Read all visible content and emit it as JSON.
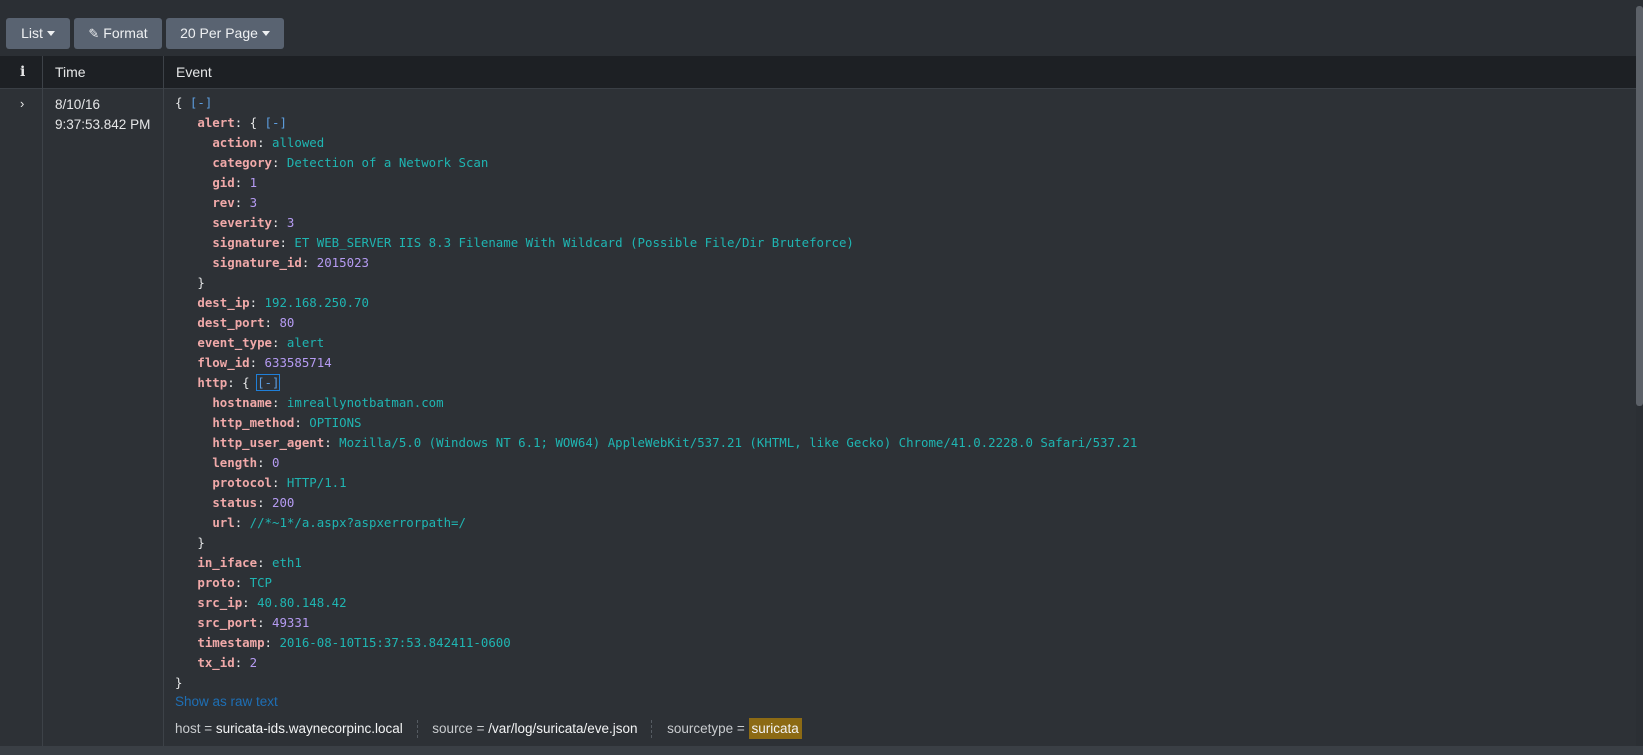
{
  "toolbar": {
    "list_label": "List",
    "format_label": "Format",
    "per_page_label": "20 Per Page"
  },
  "table": {
    "col_info": "i",
    "col_time": "Time",
    "col_event": "Event"
  },
  "event": {
    "time_date": "8/10/16",
    "time_clock": "9:37:53.842 PM",
    "toggle": "[-]",
    "fields": {
      "alert": "alert",
      "action_key": "action",
      "action_val": "allowed",
      "category_key": "category",
      "category_val": "Detection of a Network Scan",
      "gid_key": "gid",
      "gid_val": "1",
      "rev_key": "rev",
      "rev_val": "3",
      "severity_key": "severity",
      "severity_val": "3",
      "signature_key": "signature",
      "signature_val": "ET WEB_SERVER IIS 8.3 Filename With Wildcard (Possible File/Dir Bruteforce)",
      "signature_id_key": "signature_id",
      "signature_id_val": "2015023",
      "dest_ip_key": "dest_ip",
      "dest_ip_val": "192.168.250.70",
      "dest_port_key": "dest_port",
      "dest_port_val": "80",
      "event_type_key": "event_type",
      "event_type_val": "alert",
      "flow_id_key": "flow_id",
      "flow_id_val": "633585714",
      "http": "http",
      "hostname_key": "hostname",
      "hostname_val": "imreallynotbatman.com",
      "http_method_key": "http_method",
      "http_method_val": "OPTIONS",
      "http_user_agent_key": "http_user_agent",
      "http_user_agent_val": "Mozilla/5.0 (Windows NT 6.1; WOW64) AppleWebKit/537.21 (KHTML, like Gecko) Chrome/41.0.2228.0 Safari/537.21",
      "length_key": "length",
      "length_val": "0",
      "protocol_key": "protocol",
      "protocol_val": "HTTP/1.1",
      "status_key": "status",
      "status_val": "200",
      "url_key": "url",
      "url_val": "//*~1*/a.aspx?aspxerrorpath=/",
      "in_iface_key": "in_iface",
      "in_iface_val": "eth1",
      "proto_key": "proto",
      "proto_val": "TCP",
      "src_ip_key": "src_ip",
      "src_ip_val": "40.80.148.42",
      "src_port_key": "src_port",
      "src_port_val": "49331",
      "timestamp_key": "timestamp",
      "timestamp_val": "2016-08-10T15:37:53.842411-0600",
      "tx_id_key": "tx_id",
      "tx_id_val": "2"
    },
    "show_raw": "Show as raw text",
    "meta": {
      "host_label": "host =",
      "host_val": "suricata-ids.waynecorpinc.local",
      "source_label": "source =",
      "source_val": "/var/log/suricata/eve.json",
      "sourcetype_label": "sourcetype =",
      "sourcetype_val": "suricata"
    }
  },
  "colors": {
    "key": "#f0a9a9",
    "string": "#1fb5b2",
    "number": "#b59bf2",
    "highlight": "#8c6a14"
  }
}
